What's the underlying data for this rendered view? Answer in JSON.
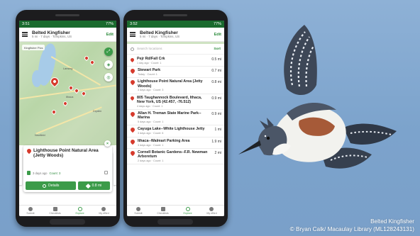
{
  "left_phone": {
    "status": {
      "time": "3:51",
      "right": "77%"
    },
    "app": {
      "title": "Belted Kingfisher",
      "subtitle": "5 mi · 7 days · Tompkins, US",
      "edit": "Edit"
    },
    "map": {
      "chip": "Kingfisher Pics",
      "towns": [
        "Lansing",
        "Ithaca",
        "Dryden",
        "Newfield"
      ]
    },
    "card": {
      "title": "Lighthouse Point Natural Area (Jetty Woods)",
      "age": "3 days ago",
      "count": "Count: 3",
      "details_label": "Details",
      "distance_label": "0.8 mi",
      "close": "×"
    },
    "nav": [
      {
        "label": "Submit"
      },
      {
        "label": "Checklists"
      },
      {
        "label": "Explore"
      },
      {
        "label": "My eBird"
      }
    ]
  },
  "right_phone": {
    "status": {
      "time": "3:52",
      "right": "77%"
    },
    "app": {
      "title": "Belted Kingfisher",
      "subtitle": "5 mi · 7 days · Tompkins, US",
      "edit": "Edit"
    },
    "search": {
      "placeholder": "Search locations",
      "sort": "Sort"
    },
    "rows": [
      {
        "name": "Pejr Rd/Fall Crk",
        "meta": "1 day ago · Count: 1",
        "dist": "0.5 mi"
      },
      {
        "name": "Stewart Park",
        "meta": "Today · Count: 1",
        "dist": "0.7 mi"
      },
      {
        "name": "Lighthouse Point Natural Area (Jetty Woods)",
        "meta": "3 days ago · Count: 3",
        "dist": "0.8 mi"
      },
      {
        "name": "805 Taughannock Boulevard, Ithaca, New York, US (42.457, -76.512)",
        "meta": "4 days ago · Count: 1",
        "dist": "0.9 mi"
      },
      {
        "name": "Allan H. Treman State Marine Park--Marina",
        "meta": "5 days ago · Count: 1",
        "dist": "0.9 mi"
      },
      {
        "name": "Cayuga Lake--White Lighthouse Jetty",
        "meta": "3 days ago · Count: 6",
        "dist": "1 mi"
      },
      {
        "name": "Ithaca--Walmart Parking Area",
        "meta": "3 days ago · Count: 1",
        "dist": "1.9 mi"
      },
      {
        "name": "Cornell Botanic Gardens--F.R. Newman Arboretum",
        "meta": "2 days ago · Count: 1",
        "dist": "2 mi"
      }
    ],
    "nav": [
      {
        "label": "Submit"
      },
      {
        "label": "Checklists"
      },
      {
        "label": "Explore"
      },
      {
        "label": "My eBird"
      }
    ]
  },
  "credit": {
    "line1": "Belted Kingfisher",
    "line2": "© Bryan Calk/ Macaulay Library (ML128243131)"
  },
  "colors": {
    "accent": "#3c9b49",
    "pin": "#d63a2c",
    "statusbar": "#1a6b2e",
    "background": "#7ca3cc"
  }
}
